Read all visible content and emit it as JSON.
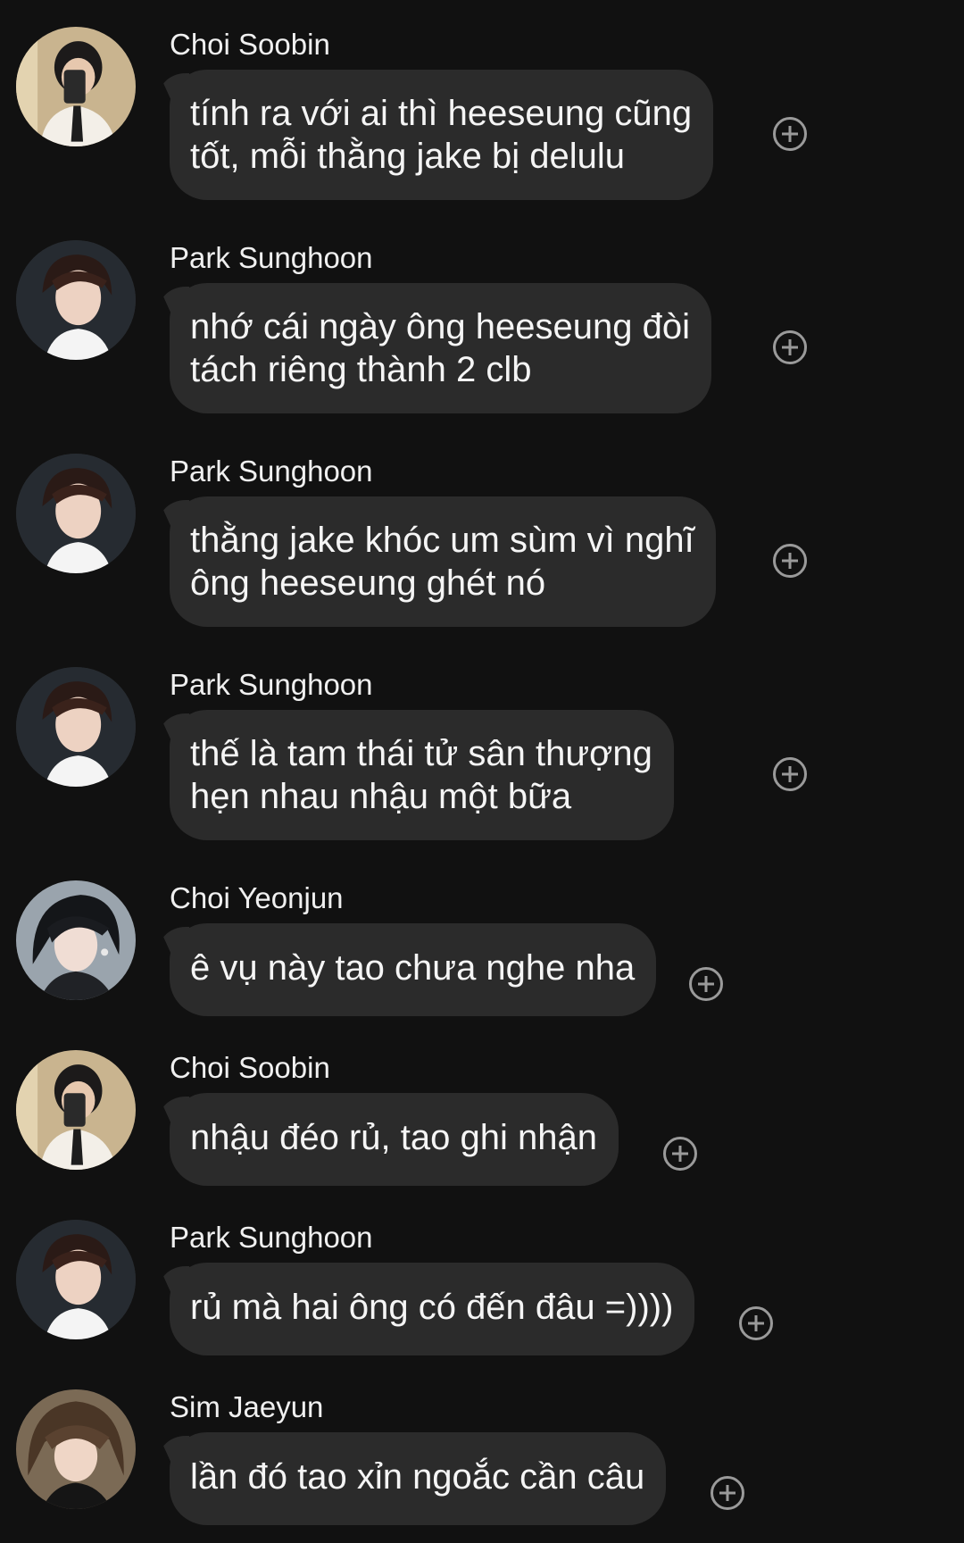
{
  "messages": [
    {
      "sender": "Choi Soobin",
      "avatar": "soobin",
      "lines": [
        "tính ra với ai thì heeseung cũng",
        "tốt, mỗi thằng jake bị delulu"
      ]
    },
    {
      "sender": "Park Sunghoon",
      "avatar": "sunghoon",
      "lines": [
        "nhớ cái ngày ông heeseung đòi",
        "tách riêng thành 2 clb"
      ]
    },
    {
      "sender": "Park Sunghoon",
      "avatar": "sunghoon",
      "lines": [
        "thằng jake khóc um sùm vì nghĩ",
        "ông heeseung ghét nó"
      ]
    },
    {
      "sender": "Park Sunghoon",
      "avatar": "sunghoon",
      "lines": [
        "thế là tam thái tử sân thượng",
        "hẹn nhau nhậu một bữa"
      ]
    },
    {
      "sender": "Choi Yeonjun",
      "avatar": "yeonjun",
      "lines": [
        "ê vụ này tao chưa nghe nha"
      ]
    },
    {
      "sender": "Choi Soobin",
      "avatar": "soobin",
      "lines": [
        "nhậu đéo rủ, tao ghi nhận"
      ]
    },
    {
      "sender": "Park Sunghoon",
      "avatar": "sunghoon",
      "lines": [
        "rủ mà hai ông có đến đâu =))))"
      ]
    },
    {
      "sender": "Sim Jaeyun",
      "avatar": "jaeyun",
      "lines": [
        "lần đó tao xỉn ngoắc cần câu"
      ]
    }
  ],
  "icons": {
    "reaction": "add-reaction-icon"
  },
  "colors": {
    "background": "#111111",
    "bubble": "#2b2b2b",
    "text": "#f5f5f5",
    "icon": "#9a9a9a"
  }
}
